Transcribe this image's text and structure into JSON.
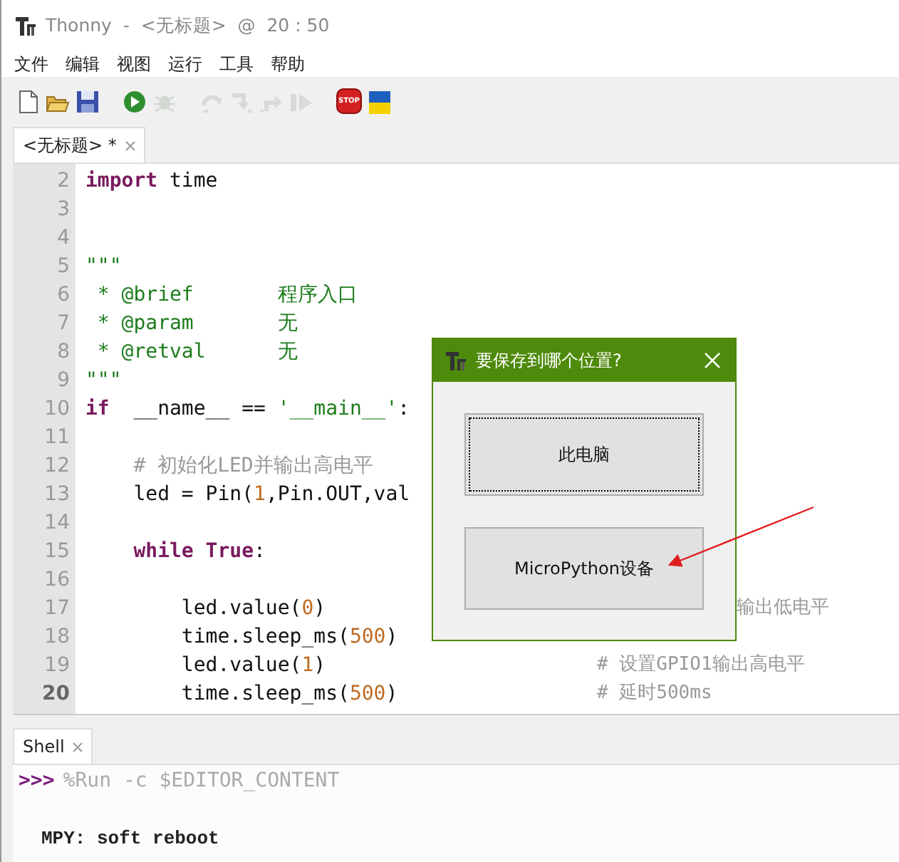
{
  "window": {
    "title": "Thonny  -  <无标题>  @  20 : 50"
  },
  "menu": [
    "文件",
    "编辑",
    "视图",
    "运行",
    "工具",
    "帮助"
  ],
  "toolbar": [
    {
      "kind": "new",
      "disabled": false
    },
    {
      "kind": "open",
      "disabled": false
    },
    {
      "kind": "save",
      "disabled": false
    },
    {
      "kind": "run",
      "disabled": false
    },
    {
      "kind": "debug",
      "disabled": true
    },
    {
      "kind": "step-over",
      "disabled": true
    },
    {
      "kind": "step-into",
      "disabled": true
    },
    {
      "kind": "step-out",
      "disabled": true
    },
    {
      "kind": "resume",
      "disabled": true
    },
    {
      "kind": "stop",
      "disabled": false,
      "label": "STOP"
    },
    {
      "kind": "flag",
      "disabled": false
    }
  ],
  "editor_tabs": [
    {
      "label": "<无标题> *",
      "selected": true
    }
  ],
  "editor": {
    "lines": [
      {
        "number": "2",
        "current": false,
        "tokens": [
          {
            "kind": "keyword",
            "text": "import"
          },
          {
            "kind": "plain",
            "text": " time"
          }
        ]
      },
      {
        "number": "3",
        "current": false
      },
      {
        "number": "4",
        "current": false
      },
      {
        "number": "5",
        "current": false,
        "tokens": [
          {
            "kind": "string",
            "text": "\"\"\""
          }
        ]
      },
      {
        "number": "6",
        "current": false,
        "tokens": [
          {
            "kind": "string",
            "text": " * @brief       程序入口"
          }
        ]
      },
      {
        "number": "7",
        "current": false,
        "tokens": [
          {
            "kind": "string",
            "text": " * @param       无"
          }
        ]
      },
      {
        "number": "8",
        "current": false,
        "tokens": [
          {
            "kind": "string",
            "text": " * @retval      无"
          }
        ]
      },
      {
        "number": "9",
        "current": false,
        "tokens": [
          {
            "kind": "string",
            "text": "\"\"\""
          }
        ]
      },
      {
        "number": "10",
        "current": false,
        "tokens": [
          {
            "kind": "keyword",
            "text": "if"
          },
          {
            "kind": "plain",
            "text": "  __name__ == "
          },
          {
            "kind": "string",
            "text": "'__main__'"
          },
          {
            "kind": "plain",
            "text": ":"
          }
        ]
      },
      {
        "number": "11",
        "current": false
      },
      {
        "number": "12",
        "current": false,
        "tokens": [
          {
            "kind": "comment",
            "text": "    # 初始化LED并输出高电平"
          }
        ]
      },
      {
        "number": "13",
        "current": false,
        "tokens": [
          {
            "kind": "plain",
            "text": "    led = Pin("
          },
          {
            "kind": "number",
            "text": "1"
          },
          {
            "kind": "plain",
            "text": ",Pin.OUT,val"
          }
        ]
      },
      {
        "number": "14",
        "current": false
      },
      {
        "number": "15",
        "current": false,
        "tokens": [
          {
            "kind": "keyword",
            "text": "    while True"
          },
          {
            "kind": "plain",
            "text": ":"
          }
        ]
      },
      {
        "number": "16",
        "current": false
      },
      {
        "number": "17",
        "current": false,
        "tokens": [
          {
            "kind": "plain",
            "text": "        led.value("
          },
          {
            "kind": "number",
            "text": "0"
          },
          {
            "kind": "plain",
            "text": ")"
          },
          {
            "kind": "comment_tail",
            "text": "输出低电平"
          }
        ]
      },
      {
        "number": "18",
        "current": false,
        "tokens": [
          {
            "kind": "plain",
            "text": "        time.sleep_ms("
          },
          {
            "kind": "number",
            "text": "500"
          },
          {
            "kind": "plain",
            "text": ")"
          }
        ]
      },
      {
        "number": "19",
        "current": false,
        "tokens": [
          {
            "kind": "plain",
            "text": "        led.value("
          },
          {
            "kind": "number",
            "text": "1"
          },
          {
            "kind": "plain",
            "text": ")"
          },
          {
            "kind": "comment_col",
            "text": "# 设置GPIO1输出高电平"
          }
        ]
      },
      {
        "number": "20",
        "current": true,
        "tokens": [
          {
            "kind": "plain",
            "text": "        time.sleep_ms("
          },
          {
            "kind": "number",
            "text": "500"
          },
          {
            "kind": "plain",
            "text": ")"
          },
          {
            "kind": "comment_col",
            "text": "# 延时500ms"
          }
        ]
      }
    ]
  },
  "shell_tabs": [
    {
      "label": "Shell",
      "selected": true
    }
  ],
  "shell": {
    "prompt": ">>>",
    "command": "%Run -c $EDITOR_CONTENT",
    "output": "MPY: soft reboot"
  },
  "dialog": {
    "title": "要保存到哪个位置?",
    "buttons": [
      {
        "label": "此电脑",
        "focused": true
      },
      {
        "label": "MicroPython设备",
        "focused": false
      }
    ]
  }
}
